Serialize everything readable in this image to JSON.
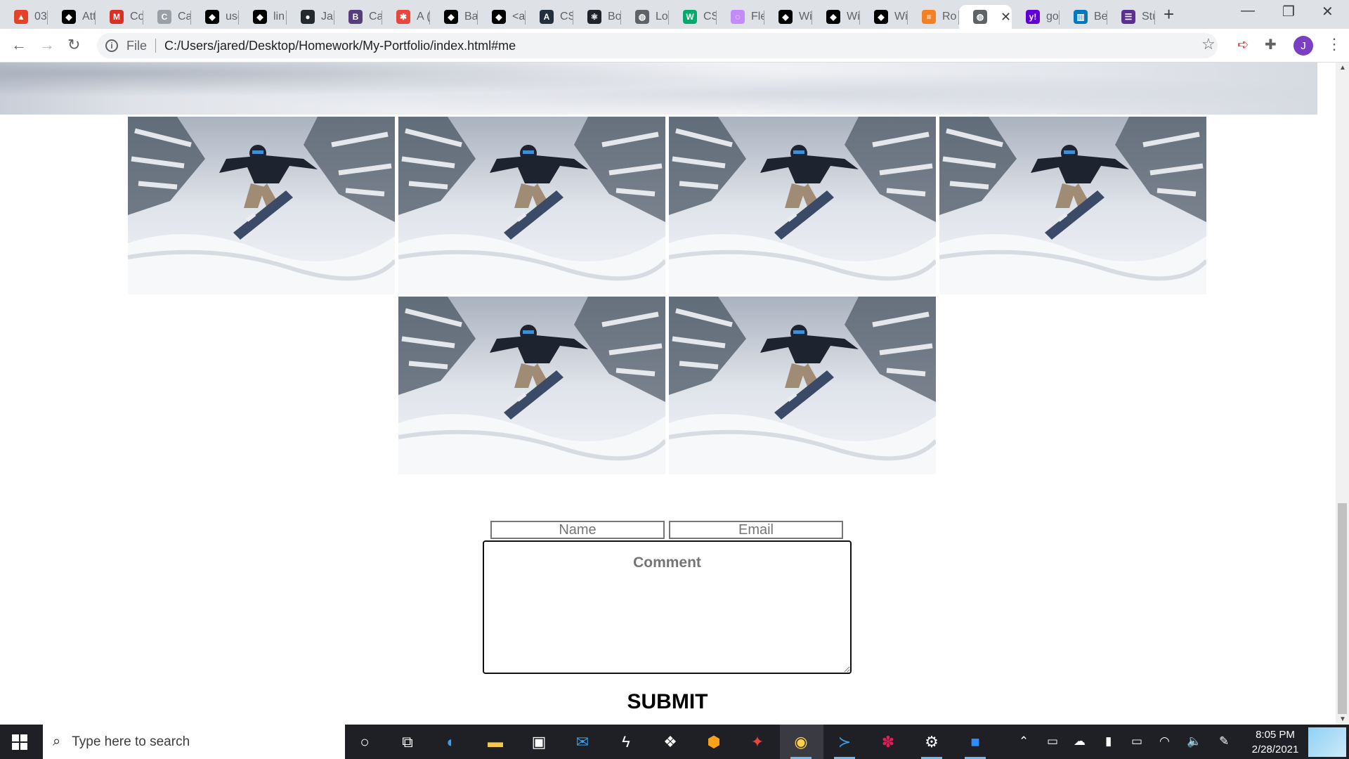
{
  "browser": {
    "tabs": [
      {
        "label": "03",
        "icon": "gitlab-icon",
        "color": "#e24329",
        "glyph": "▲"
      },
      {
        "label": "Att",
        "icon": "github-alt-icon",
        "color": "#000000",
        "glyph": "◆"
      },
      {
        "label": "Co",
        "icon": "gmail-icon",
        "color": "#d93025",
        "glyph": "M"
      },
      {
        "label": "Ca",
        "icon": "calendar-icon",
        "color": "#9aa0a6",
        "glyph": "C"
      },
      {
        "label": "use",
        "icon": "github-alt-icon",
        "color": "#000000",
        "glyph": "◆"
      },
      {
        "label": "lin",
        "icon": "github-alt-icon",
        "color": "#000000",
        "glyph": "◆"
      },
      {
        "label": "Jar",
        "icon": "github-icon",
        "color": "#24292e",
        "glyph": "●"
      },
      {
        "label": "Ca",
        "icon": "bootstrap-icon",
        "color": "#563d7c",
        "glyph": "B"
      },
      {
        "label": "A (",
        "icon": "asterisk-icon",
        "color": "#e8453c",
        "glyph": "✱"
      },
      {
        "label": "Ba",
        "icon": "github-alt-icon",
        "color": "#000000",
        "glyph": "◆"
      },
      {
        "label": "<a",
        "icon": "github-alt-icon",
        "color": "#000000",
        "glyph": "◆"
      },
      {
        "label": "CS",
        "icon": "aws-icon",
        "color": "#232f3e",
        "glyph": "A"
      },
      {
        "label": "Bo",
        "icon": "react-icon",
        "color": "#20232a",
        "glyph": "⚛"
      },
      {
        "label": "Lo",
        "icon": "globe-icon",
        "color": "#5f6368",
        "glyph": "◍"
      },
      {
        "label": "CS",
        "icon": "w3schools-icon",
        "color": "#04aa6d",
        "glyph": "W"
      },
      {
        "label": "Fle",
        "icon": "flexbox-icon",
        "color": "#c58af9",
        "glyph": "◌"
      },
      {
        "label": "Wi",
        "icon": "github-alt-icon",
        "color": "#000000",
        "glyph": "◆"
      },
      {
        "label": "Wi",
        "icon": "github-alt-icon",
        "color": "#000000",
        "glyph": "◆"
      },
      {
        "label": "Wi",
        "icon": "github-alt-icon",
        "color": "#000000",
        "glyph": "◆"
      },
      {
        "label": "Ro",
        "icon": "stackoverflow-icon",
        "color": "#f48024",
        "glyph": "≡"
      },
      {
        "label": "",
        "icon": "globe-icon",
        "color": "#5f6368",
        "glyph": "◍",
        "active": true
      },
      {
        "label": "go",
        "icon": "yahoo-icon",
        "color": "#6001d2",
        "glyph": "y!"
      },
      {
        "label": "Be",
        "icon": "trello-icon",
        "color": "#0079bf",
        "glyph": "▥"
      },
      {
        "label": "Stu",
        "icon": "list-icon",
        "color": "#5b2e91",
        "glyph": "☰"
      }
    ],
    "active_tab_close": "✕",
    "new_tab": "+",
    "window_controls": {
      "minimize": "—",
      "restore": "❐",
      "close": "✕"
    },
    "address": {
      "scheme": "File",
      "url": "C:/Users/jared/Desktop/Homework/My-Portfolio/index.html#me"
    },
    "profile_initial": "J"
  },
  "page": {
    "gallery_count": 6,
    "form": {
      "name_placeholder": "Name",
      "email_placeholder": "Email",
      "comment_placeholder": "Comment",
      "submit_label": "SUBMIT"
    }
  },
  "taskbar": {
    "search_placeholder": "Type here to search",
    "time": "8:05 PM",
    "date": "2/28/2021"
  }
}
